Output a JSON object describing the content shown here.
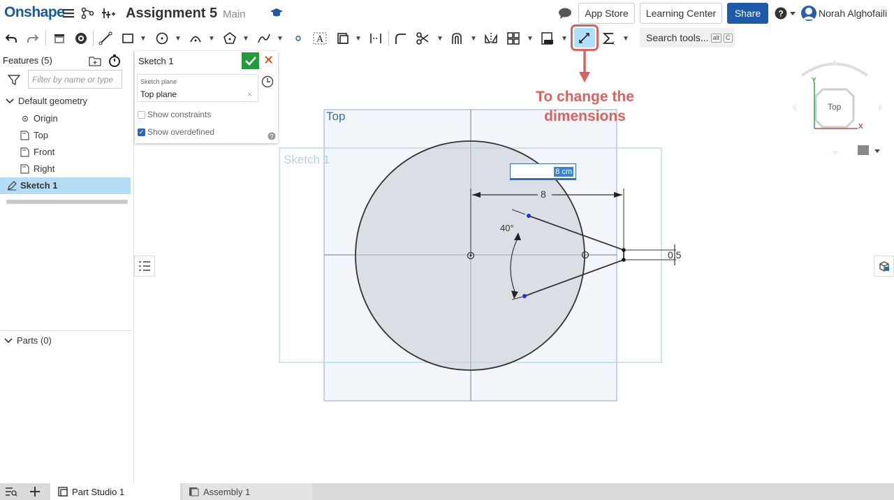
{
  "app": {
    "logo": "Onshape",
    "doc_title": "Assignment 5",
    "branch": "Main"
  },
  "header": {
    "app_store": "App Store",
    "learning_center": "Learning Center",
    "share": "Share",
    "user": "Norah Alghofaili"
  },
  "toolbar": {
    "search_tools": "Search tools...",
    "kbd_alt": "alt",
    "kbd_c": "C"
  },
  "annotation": {
    "line1": "To change the",
    "line2": "dimensions"
  },
  "features": {
    "header": "Features (5)",
    "filter_placeholder": "Filter by name or type",
    "default_geometry": "Default geometry",
    "items": [
      "Origin",
      "Top",
      "Front",
      "Right"
    ],
    "sketch": "Sketch 1",
    "parts": "Parts (0)"
  },
  "sketch_dialog": {
    "title": "Sketch 1",
    "plane_label": "Sketch plane",
    "plane_value": "Top plane",
    "show_constraints": "Show constraints",
    "show_overdefined": "Show overdefined"
  },
  "canvas": {
    "plane_label": "Top",
    "sketch_label": "Sketch 1",
    "dim_input_value": "8 cm",
    "dim_horizontal": "8",
    "dim_angle": "40°",
    "dim_small": "0.5"
  },
  "view_cube": {
    "face": "Top",
    "axis_y": "Y",
    "axis_x": "X"
  },
  "tabs": {
    "part_studio": "Part Studio 1",
    "assembly": "Assembly 1"
  },
  "colors": {
    "accent": "#1d5ba8",
    "annotation": "#d9625f",
    "selection": "#b5dcf5",
    "confirm": "#249a3a"
  }
}
